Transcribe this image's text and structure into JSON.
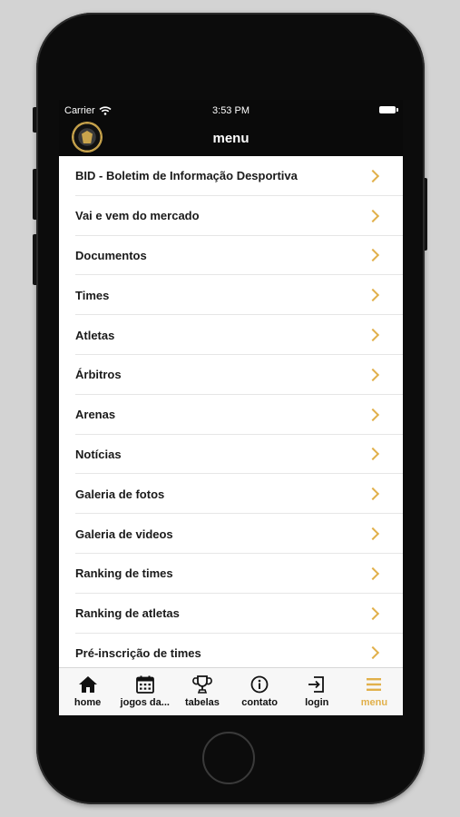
{
  "status_bar": {
    "carrier": "Carrier",
    "time": "3:53 PM"
  },
  "nav": {
    "title": "menu"
  },
  "menu_items": [
    "BID - Boletim de Informação Desportiva",
    "Vai e vem do mercado",
    "Documentos",
    "Times",
    "Atletas",
    "Árbitros",
    "Arenas",
    "Notícias",
    "Galeria de fotos",
    "Galeria de videos",
    "Ranking de times",
    "Ranking de atletas",
    "Pré-inscrição de times"
  ],
  "tabs": [
    {
      "label": "home",
      "icon": "home-icon"
    },
    {
      "label": "jogos da...",
      "icon": "calendar-icon"
    },
    {
      "label": "tabelas",
      "icon": "trophy-icon"
    },
    {
      "label": "contato",
      "icon": "info-icon"
    },
    {
      "label": "login",
      "icon": "login-icon"
    },
    {
      "label": "menu",
      "icon": "hamburger-icon"
    }
  ],
  "colors": {
    "accent": "#e1b04a",
    "bar": "#0a0a0a"
  }
}
